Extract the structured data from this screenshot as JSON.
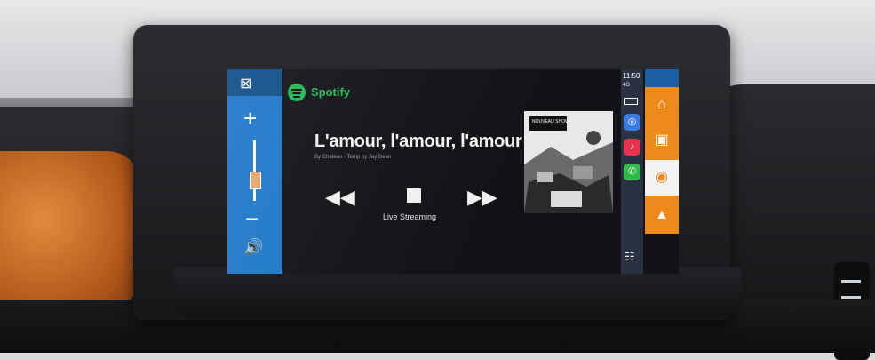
{
  "app": {
    "name": "Spotify",
    "brand_color": "#1db954"
  },
  "now_playing": {
    "title": "L'amour, l'amour, l'amour",
    "subtitle": "By Chateau - Temp by Jay Dean",
    "status": "Live Streaming",
    "album_art_label": "NOUVEAU SHOW"
  },
  "controls": {
    "rewind_icon": "rewind-icon",
    "stop_icon": "stop-icon",
    "forward_icon": "fast-forward-icon"
  },
  "volume_bar": {
    "color": "#1f78c8",
    "plus": "+",
    "minus": "−",
    "level": 0.35
  },
  "dock": {
    "time": "11:50",
    "signal": "4G",
    "apps": [
      {
        "name": "maps",
        "color": "#3a7be0"
      },
      {
        "name": "music",
        "color": "#e8334f"
      },
      {
        "name": "phone",
        "color": "#33b84a"
      }
    ]
  },
  "vehicle_bar": {
    "color": "#ee8a1c",
    "buttons": [
      "home-icon",
      "camera-icon",
      "media-icon",
      "navigation-icon"
    ]
  }
}
